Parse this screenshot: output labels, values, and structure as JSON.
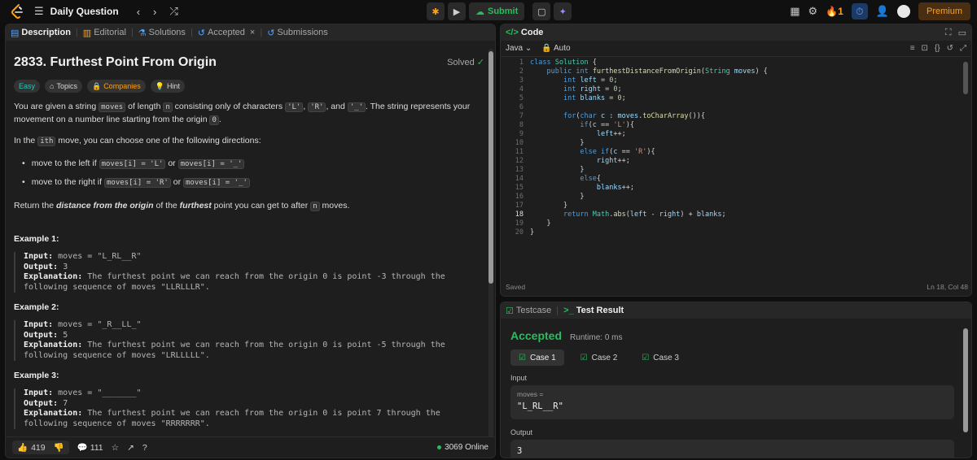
{
  "nav": {
    "title": "Daily Question",
    "submit_label": "Submit",
    "streak": "1",
    "premium_label": "Premium"
  },
  "left_tabs": {
    "description": "Description",
    "editorial": "Editorial",
    "solutions": "Solutions",
    "accepted": "Accepted",
    "submissions": "Submissions"
  },
  "problem": {
    "title": "2833. Furthest Point From Origin",
    "status": "Solved",
    "tags": {
      "difficulty": "Easy",
      "topics": "Topics",
      "companies": "Companies",
      "hint": "Hint"
    },
    "p1_a": "You are given a string ",
    "p1_code1": "moves",
    "p1_b": " of length ",
    "p1_code2": "n",
    "p1_c": " consisting only of characters ",
    "p1_code3": "'L'",
    "p1_d": ", ",
    "p1_code4": "'R'",
    "p1_e": ", and ",
    "p1_code5": "'_'",
    "p1_f": ". The string represents your movement on a number line starting from the origin ",
    "p1_code6": "0",
    "p1_g": ".",
    "p2_a": "In the ",
    "p2_code": "ith",
    "p2_b": " move, you can choose one of the following directions:",
    "b1_a": "move to the left if ",
    "b1_code1": "moves[i] = 'L'",
    "b1_or": " or ",
    "b1_code2": "moves[i] = '_'",
    "b2_a": "move to the right if ",
    "b2_code1": "moves[i] = 'R'",
    "b2_or": " or ",
    "b2_code2": "moves[i] = '_'",
    "p3_a": "Return the ",
    "p3_em1": "distance from the origin",
    "p3_b": " of the ",
    "p3_em2": "furthest",
    "p3_c": " point you can get to after ",
    "p3_code": "n",
    "p3_d": " moves.",
    "examples": [
      {
        "title": "Example 1:",
        "input": "moves = \"L_RL__R\"",
        "output": "3",
        "explanation": "The furthest point we can reach from the origin 0 is point -3 through the following sequence of moves \"LLRLLLR\"."
      },
      {
        "title": "Example 2:",
        "input": "moves = \"_R__LL_\"",
        "output": "5",
        "explanation": "The furthest point we can reach from the origin 0 is point -5 through the following sequence of moves \"LRLLLLL\"."
      },
      {
        "title": "Example 3:",
        "input": "moves = \"_______\"",
        "output": "7",
        "explanation": "The furthest point we can reach from the origin 0 is point 7 through the following sequence of moves \"RRRRRRR\"."
      }
    ],
    "labels": {
      "input": "Input:",
      "output": "Output:",
      "explanation": "Explanation:"
    }
  },
  "footer": {
    "likes": "419",
    "comments": "111",
    "online": "3069 Online"
  },
  "code": {
    "title": "Code",
    "language": "Java",
    "mode": "Auto",
    "status": "Saved",
    "cursor": "Ln 18, Col 48"
  },
  "result": {
    "tab_testcase": "Testcase",
    "tab_result": "Test Result",
    "verdict": "Accepted",
    "runtime": "Runtime: 0 ms",
    "cases": [
      "Case 1",
      "Case 2",
      "Case 3"
    ],
    "input_label": "Input",
    "input_key": "moves =",
    "input_value": "\"L_RL__R\"",
    "output_label": "Output",
    "output_value": "3"
  }
}
